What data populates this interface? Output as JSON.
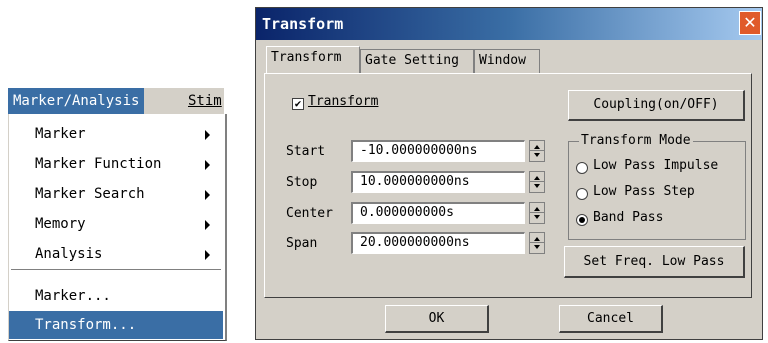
{
  "menu": {
    "bar": {
      "active": "Marker/Analysis",
      "next": "Stim"
    },
    "items": [
      {
        "label": "Marker",
        "submenu": true
      },
      {
        "label": "Marker Function",
        "submenu": true
      },
      {
        "label": "Marker Search",
        "submenu": true
      },
      {
        "label": "Memory",
        "submenu": true
      },
      {
        "label": "Analysis",
        "submenu": true
      },
      {
        "label": "Marker...",
        "submenu": false
      },
      {
        "label": "Transform...",
        "submenu": false,
        "selected": true
      }
    ]
  },
  "dialog": {
    "title": "Transform",
    "close": "✕",
    "tabs": [
      "Transform",
      "Gate Setting",
      "Window"
    ],
    "active_tab": "Transform",
    "transform_checkbox": {
      "label": "Transform",
      "checked": true,
      "mark": "✔"
    },
    "coupling_button": "Coupling(on/OFF)",
    "fields": [
      {
        "label": "Start",
        "value": "-10.000000000ns"
      },
      {
        "label": "Stop",
        "value": "10.000000000ns"
      },
      {
        "label": "Center",
        "value": "0.000000000s"
      },
      {
        "label": "Span",
        "value": "20.000000000ns"
      }
    ],
    "mode_group": {
      "title": "Transform Mode",
      "options": [
        "Low Pass Impulse",
        "Low Pass Step",
        "Band Pass"
      ],
      "selected": "Band Pass"
    },
    "set_freq_button": "Set Freq. Low Pass",
    "ok_button": "OK",
    "cancel_button": "Cancel"
  },
  "colors": {
    "face": "#d4d0c8",
    "highlight": "#3a6ea5",
    "title_start": "#0a246a",
    "close": "#e05a2a"
  }
}
